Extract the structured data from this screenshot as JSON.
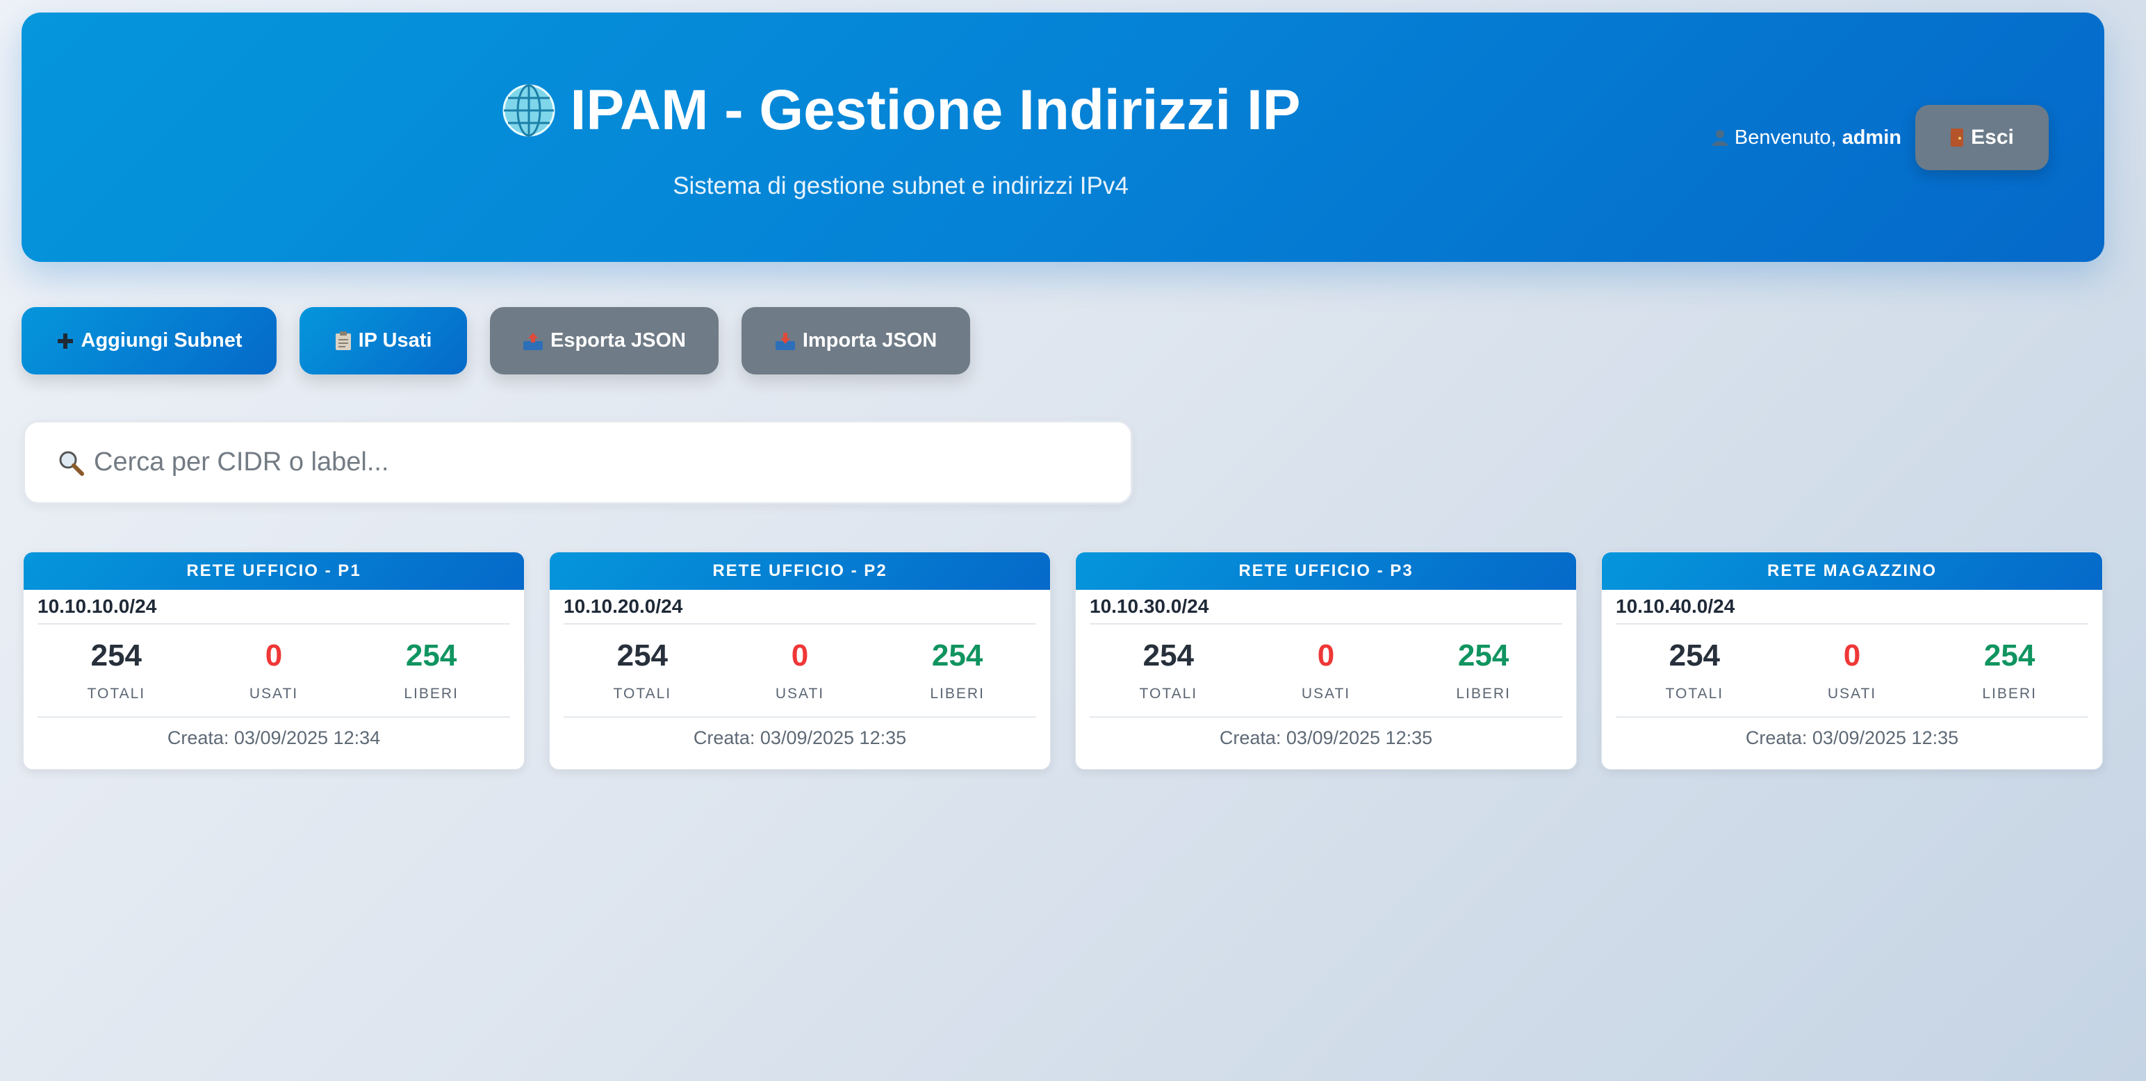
{
  "header": {
    "title": "IPAM - Gestione Indirizzi IP",
    "subtitle": "Sistema di gestione subnet e indirizzi IPv4",
    "welcome_text": "Benvenuto,",
    "username": "admin",
    "logout_label": "Esci"
  },
  "toolbar": {
    "add_subnet_label": "Aggiungi Subnet",
    "used_ips_label": "IP Usati",
    "export_label": "Esporta JSON",
    "import_label": "Importa JSON"
  },
  "search": {
    "placeholder": "Cerca per CIDR o label..."
  },
  "subnets": [
    {
      "label": "RETE UFFICIO - P1",
      "cidr": "10.10.10.0/24",
      "total": "254",
      "used": "0",
      "free": "254",
      "created": "Creata: 03/09/2025 12:34"
    },
    {
      "label": "RETE UFFICIO - P2",
      "cidr": "10.10.20.0/24",
      "total": "254",
      "used": "0",
      "free": "254",
      "created": "Creata: 03/09/2025 12:35"
    },
    {
      "label": "RETE UFFICIO - P3",
      "cidr": "10.10.30.0/24",
      "total": "254",
      "used": "0",
      "free": "254",
      "created": "Creata: 03/09/2025 12:35"
    },
    {
      "label": "RETE MAGAZZINO",
      "cidr": "10.10.40.0/24",
      "total": "254",
      "used": "0",
      "free": "254",
      "created": "Creata: 03/09/2025 12:35"
    }
  ],
  "stat_labels": {
    "total": "TOTALI",
    "used": "USATI",
    "free": "LIBERI"
  },
  "colors": {
    "accent": "#0582d6",
    "used": "#ef3737",
    "free": "#109460",
    "secondary_button": "#6f7b86"
  }
}
